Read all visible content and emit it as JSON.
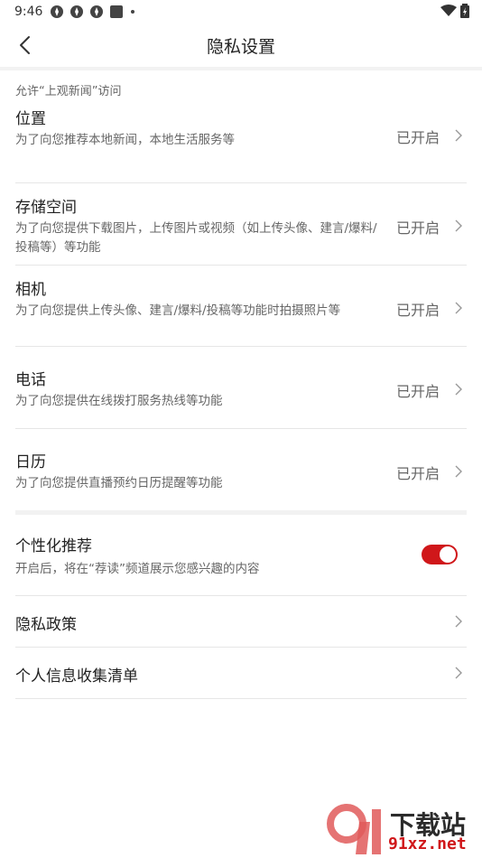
{
  "statusbar": {
    "time": "9:46"
  },
  "header": {
    "title": "隐私设置"
  },
  "section_label": "允许“上观新闻”访问",
  "permissions": [
    {
      "title": "位置",
      "desc": "为了向您推荐本地新闻，本地生活服务等",
      "status": "已开启"
    },
    {
      "title": "存储空间",
      "desc": "为了向您提供下载图片，上传图片或视频（如上传头像、建言/爆料/投稿等）等功能",
      "status": "已开启"
    },
    {
      "title": "相机",
      "desc": "为了向您提供上传头像、建言/爆料/投稿等功能时拍摄照片等",
      "status": "已开启"
    },
    {
      "title": "电话",
      "desc": "为了向您提供在线拨打服务热线等功能",
      "status": "已开启"
    },
    {
      "title": "日历",
      "desc": "为了向您提供直播预约日历提醒等功能",
      "status": "已开启"
    }
  ],
  "personalized": {
    "title": "个性化推荐",
    "desc": "开启后，将在“荐读”频道展示您感兴趣的内容",
    "enabled": true
  },
  "links": {
    "privacy_policy": "隐私政策",
    "info_list": "个人信息收集清单"
  },
  "watermark": {
    "brand": "下载站",
    "url": "91xz.net"
  },
  "colors": {
    "accent": "#d0171a",
    "divider": "#e6e6e6"
  }
}
